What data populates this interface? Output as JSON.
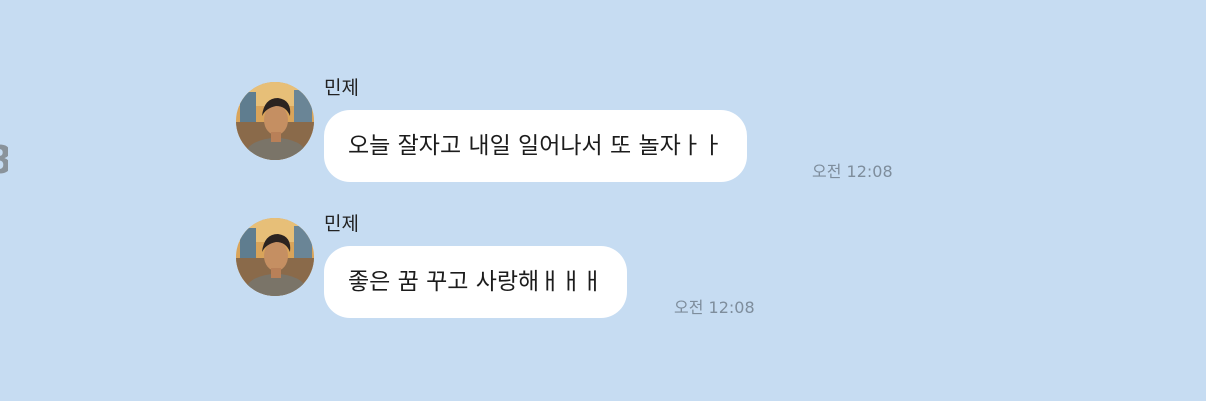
{
  "messages": [
    {
      "sender": "민제",
      "text": "오늘 잘자고 내일 일어나서 또 놀자ㅏㅏ",
      "time": "오전 12:08"
    },
    {
      "sender": "민제",
      "text": "좋은 꿈 꾸고 사랑해ㅐㅐㅐ",
      "time": "오전 12:08"
    }
  ],
  "colors": {
    "chat_background": "#c6dcf2",
    "bubble": "#ffffff",
    "timestamp": "#7e8d9c"
  }
}
